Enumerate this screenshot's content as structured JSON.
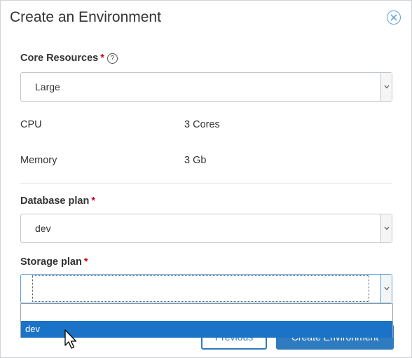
{
  "dialog": {
    "title": "Create an Environment",
    "close_icon": "close-circle-icon"
  },
  "core_resources": {
    "label": "Core Resources",
    "required_mark": "*",
    "help_glyph": "?",
    "selected": "Large"
  },
  "specs": {
    "cpu_label": "CPU",
    "cpu_value": "3 Cores",
    "memory_label": "Memory",
    "memory_value": "3 Gb"
  },
  "database_plan": {
    "label": "Database plan",
    "required_mark": "*",
    "selected": "dev"
  },
  "storage_plan": {
    "label": "Storage plan",
    "required_mark": "*",
    "selected": "",
    "options": [
      "",
      "dev"
    ],
    "highlighted_option": "dev"
  },
  "footer": {
    "previous_label": "Previous",
    "create_label": "Create Environment"
  },
  "colors": {
    "accent": "#2f7bbf",
    "focus_border": "#5aa0d8",
    "highlight": "#1a73c6",
    "required": "#d0021b"
  }
}
